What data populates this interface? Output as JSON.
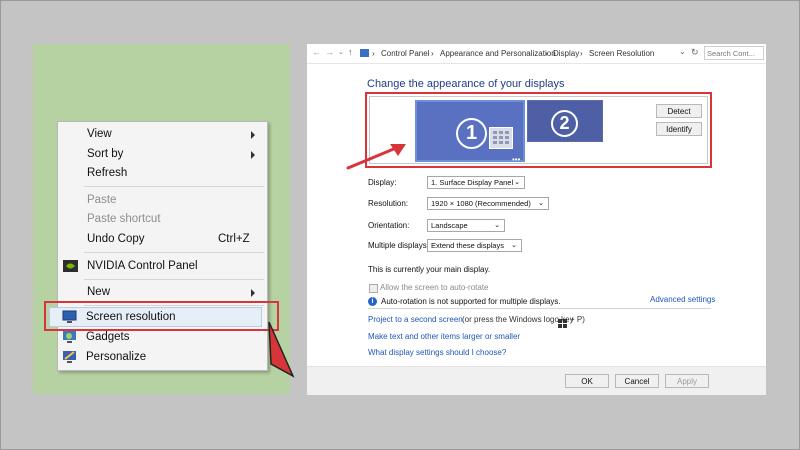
{
  "context_menu": {
    "items": [
      {
        "label": "View"
      },
      {
        "label": "Sort by"
      },
      {
        "label": "Refresh"
      },
      {
        "label": "Paste"
      },
      {
        "label": "Paste shortcut"
      },
      {
        "label": "Undo Copy",
        "shortcut": "Ctrl+Z"
      },
      {
        "label": "NVIDIA Control Panel"
      },
      {
        "label": "New"
      },
      {
        "label": "Screen resolution"
      },
      {
        "label": "Gadgets"
      },
      {
        "label": "Personalize"
      }
    ]
  },
  "window": {
    "breadcrumb": [
      "Control Panel",
      "Appearance and Personalization",
      "Display",
      "Screen Resolution"
    ],
    "search_placeholder": "Search Cont...",
    "heading": "Change the appearance of your displays",
    "monitors": [
      "1",
      "2"
    ],
    "detect_label": "Detect",
    "identify_label": "Identify",
    "fields": {
      "display": {
        "label": "Display:",
        "value": "1. Surface Display Panel"
      },
      "resolution": {
        "label": "Resolution:",
        "value": "1920 × 1080 (Recommended)"
      },
      "orientation": {
        "label": "Orientation:",
        "value": "Landscape"
      },
      "multiple": {
        "label": "Multiple displays:",
        "value": "Extend these displays"
      }
    },
    "main_display_text": "This is currently your main display.",
    "auto_rotate_label": "Allow the screen to auto-rotate",
    "auto_rotate_note": "Auto-rotation is not supported for multiple displays.",
    "advanced_link": "Advanced settings",
    "project_link": "Project to a second screen",
    "project_hint": "(or press the Windows logo key",
    "project_hint_end": "+ P)",
    "text_size_link": "Make text and other items larger or smaller",
    "choose_link": "What display settings should I choose?",
    "ok_label": "OK",
    "cancel_label": "Cancel",
    "apply_label": "Apply"
  },
  "colors": {
    "highlight_red": "#d8353a",
    "link_blue": "#1f56b8",
    "desktop_green": "#b7d2a2"
  }
}
